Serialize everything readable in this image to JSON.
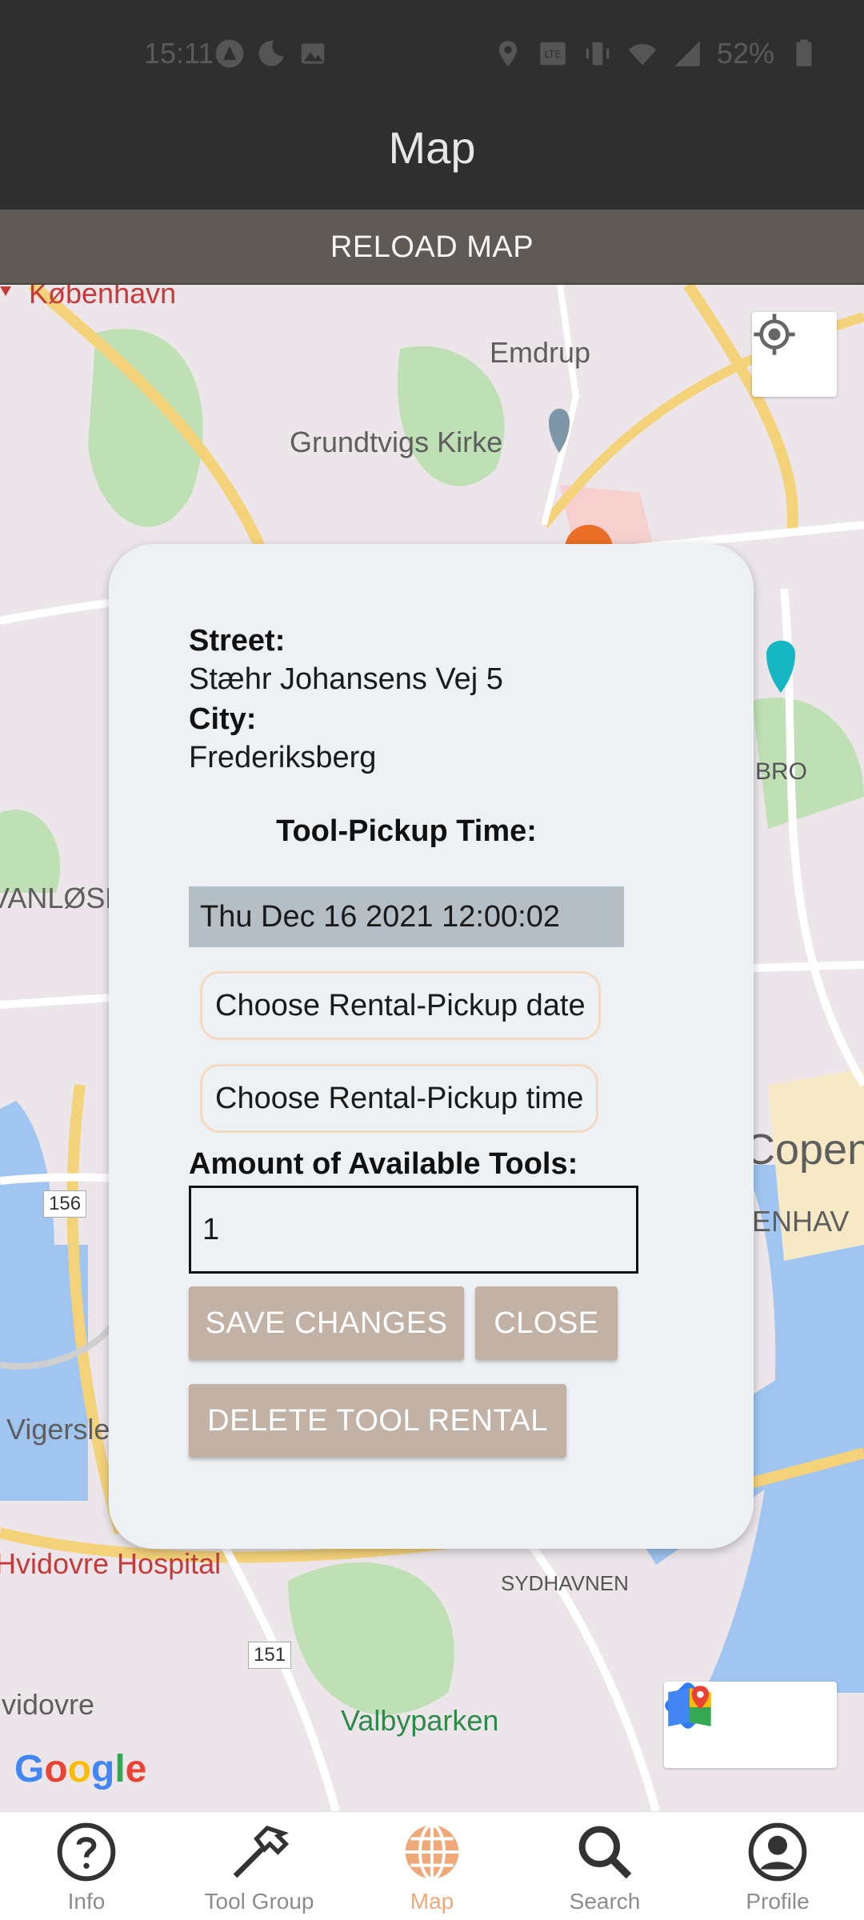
{
  "status_bar": {
    "time": "15:11",
    "battery": "52%",
    "left_icons": [
      "maps-icon",
      "night-mode-icon",
      "image-icon"
    ],
    "right_icons": [
      "location-icon",
      "volte-icon",
      "vibrate-icon",
      "wifi-icon",
      "signal-icon",
      "battery-icon"
    ]
  },
  "app_bar": {
    "title": "Map"
  },
  "reload_button": {
    "label": "RELOAD MAP"
  },
  "map": {
    "labels": {
      "kobenhavn": "København",
      "emdrup": "Emdrup",
      "grundtvigs": "Grundtvigs Kirke",
      "bro": "BRO",
      "vanlose": "VANLØSE",
      "copenhagen": "Copen",
      "enhavn": "ENHAV",
      "vigerslev": "Vigerslev",
      "hvidovre_hospital": "Hvidovre Hospital",
      "sydhavnen": "SYDHAVNEN",
      "hvidovre": "Hvidovre",
      "valbyparken": "Valbyparken",
      "road_156": "156",
      "road_151": "151"
    },
    "google_logo": [
      "G",
      "o",
      "o",
      "g",
      "l",
      "e"
    ],
    "google_colors": [
      "#4285F4",
      "#EA4335",
      "#FBBC05",
      "#4285F4",
      "#34A853",
      "#EA4335"
    ]
  },
  "modal": {
    "street_label": "Street:",
    "street_value": "Stæhr Johansens Vej 5",
    "city_label": "City:",
    "city_value": "Frederiksberg",
    "pickup_heading": "Tool-Pickup Time:",
    "pickup_datetime": "Thu Dec 16 2021 12:00:02",
    "choose_date_label": "Choose Rental-Pickup date",
    "choose_time_label": "Choose Rental-Pickup time",
    "amount_label": "Amount of Available Tools:",
    "amount_value": "1",
    "save_label": "SAVE CHANGES",
    "close_label": "CLOSE",
    "delete_label": "DELETE TOOL RENTAL"
  },
  "bottom_nav": {
    "tabs": [
      {
        "label": "Info",
        "icon": "help-circle-icon",
        "active": false
      },
      {
        "label": "Tool Group",
        "icon": "hammer-icon",
        "active": false
      },
      {
        "label": "Map",
        "icon": "globe-icon",
        "active": true
      },
      {
        "label": "Search",
        "icon": "search-icon",
        "active": false
      },
      {
        "label": "Profile",
        "icon": "account-circle-icon",
        "active": false
      }
    ],
    "active_color": "#f0a878",
    "inactive_color": "#333333"
  }
}
